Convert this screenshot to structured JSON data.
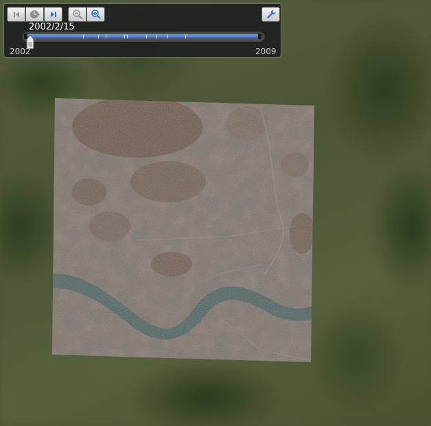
{
  "timeline": {
    "current_date": "2002/2/15",
    "start_year": "2002",
    "end_year": "2009",
    "position": 0.02,
    "buttons": [
      {
        "name": "step-back-button",
        "icon": "skip-back-icon",
        "enabled": false
      },
      {
        "name": "play-button",
        "icon": "play-clock-icon",
        "enabled": false
      },
      {
        "name": "step-forward-button",
        "icon": "skip-forward-icon",
        "enabled": true
      },
      {
        "name": "zoom-out-button",
        "icon": "zoom-out-icon",
        "enabled": false
      },
      {
        "name": "zoom-in-button",
        "icon": "zoom-in-icon",
        "enabled": true
      }
    ],
    "settings_icon": "wrench-icon"
  },
  "colors": {
    "panel_bg": "#1c1e1e",
    "bar_blue": "#3a64b8",
    "icon_blue": "#2a6fd6",
    "river": "#3a5654"
  }
}
